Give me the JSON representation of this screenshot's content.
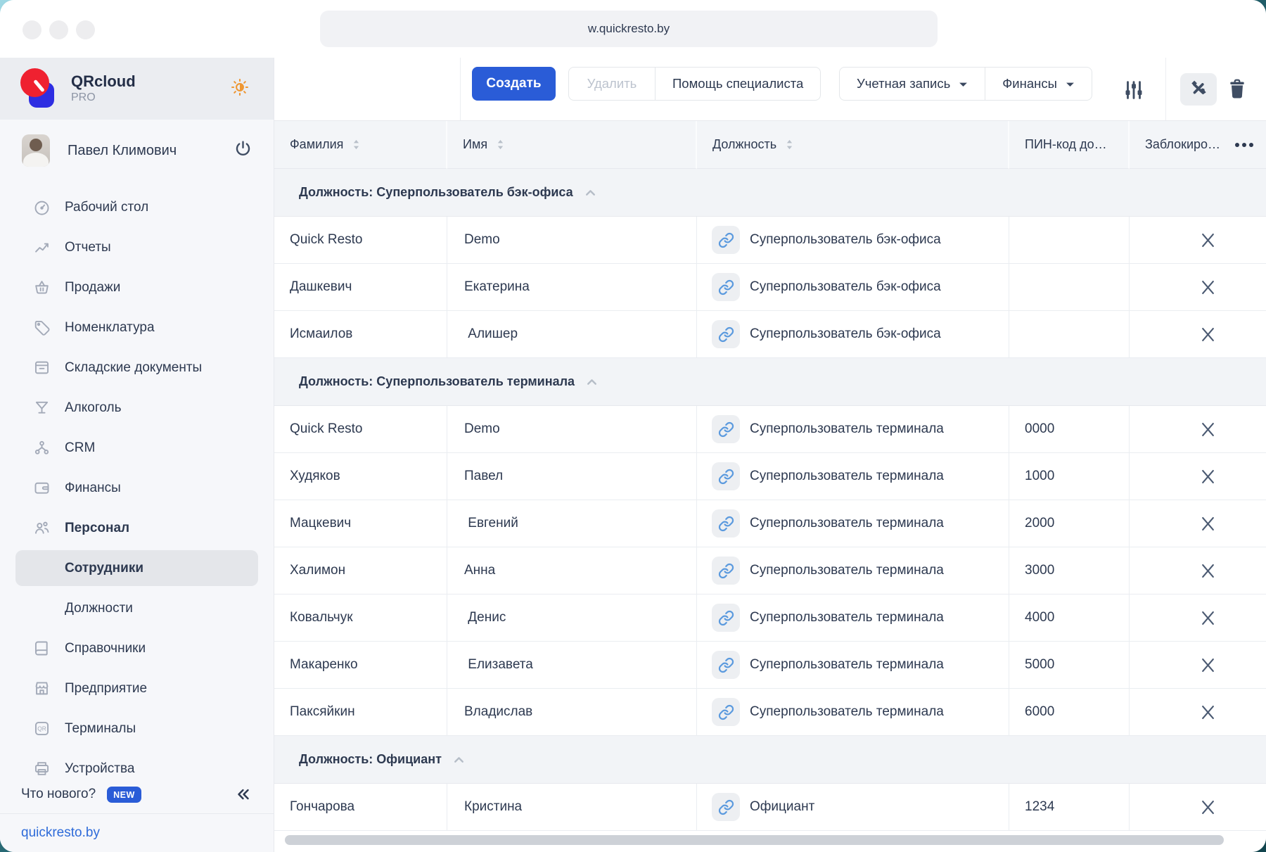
{
  "browser": {
    "url": "w.quickresto.by"
  },
  "colors": {
    "accent_blue": "#2a5cd7",
    "logo_red": "#ef2130",
    "logo_blue": "#2e2ee2",
    "link_icon_blue": "#5b9ade",
    "sun_orange": "#ee9733",
    "dark_icon": "#3f4d63",
    "disabled_text": "#bcc3ce"
  },
  "sidebar": {
    "logo": {
      "title": "QRcloud",
      "subtitle": "PRO"
    },
    "user": {
      "name": "Павел Климович"
    },
    "items": [
      {
        "key": "desktop",
        "label": "Рабочий стол",
        "icon": "dashboard-icon"
      },
      {
        "key": "reports",
        "label": "Отчеты",
        "icon": "reports-icon"
      },
      {
        "key": "sales",
        "label": "Продажи",
        "icon": "basket-icon"
      },
      {
        "key": "nomenclature",
        "label": "Номенклатура",
        "icon": "tag-icon"
      },
      {
        "key": "warehouse-docs",
        "label": "Складские документы",
        "icon": "warehouse-icon"
      },
      {
        "key": "alcohol",
        "label": "Алкоголь",
        "icon": "cocktail-icon"
      },
      {
        "key": "crm",
        "label": "CRM",
        "icon": "crm-icon"
      },
      {
        "key": "finance",
        "label": "Финансы",
        "icon": "wallet-icon"
      },
      {
        "key": "staff",
        "label": "Персонал",
        "icon": "people-icon",
        "bold": true
      },
      {
        "key": "employees",
        "label": "Сотрудники",
        "child": true,
        "selected": true
      },
      {
        "key": "positions",
        "label": "Должности",
        "child": true
      },
      {
        "key": "references",
        "label": "Справочники",
        "icon": "book-icon"
      },
      {
        "key": "enterprise",
        "label": "Предприятие",
        "icon": "storefront-icon"
      },
      {
        "key": "terminals",
        "label": "Терминалы",
        "icon": "qr-icon"
      },
      {
        "key": "devices",
        "label": "Устройства",
        "icon": "printer-icon"
      }
    ],
    "whats_new": {
      "label": "Что нового?",
      "badge": "NEW"
    },
    "site_link": "quickresto.by"
  },
  "toolbar": {
    "create_label": "Создать",
    "delete_label": "Удалить",
    "help_label": "Помощь специалиста",
    "account_label": "Учетная запись",
    "finance_label": "Финансы"
  },
  "table": {
    "columns": [
      {
        "key": "surname",
        "label": "Фамилия",
        "sortable": true
      },
      {
        "key": "name",
        "label": "Имя",
        "sortable": true
      },
      {
        "key": "role",
        "label": "Должность",
        "sortable": true
      },
      {
        "key": "pin",
        "label": "ПИН-код до…",
        "sortable": false
      },
      {
        "key": "blocked",
        "label": "Заблокиро…",
        "sortable": false
      }
    ],
    "groups": [
      {
        "title": "Должность: Суперпользователь бэк-офиса",
        "rows": [
          {
            "surname": "Quick Resto",
            "name": "Demo",
            "role": "Суперпользователь бэк-офиса",
            "pin": ""
          },
          {
            "surname": "Дашкевич",
            "name": "Екатерина",
            "role": "Суперпользователь бэк-офиса",
            "pin": ""
          },
          {
            "surname": "Исмаилов",
            "name": " Алишер",
            "role": "Суперпользователь бэк-офиса",
            "pin": ""
          }
        ]
      },
      {
        "title": "Должность: Суперпользователь терминала",
        "rows": [
          {
            "surname": "Quick Resto",
            "name": "Demo",
            "role": "Суперпользователь терминала",
            "pin": "0000"
          },
          {
            "surname": "Худяков",
            "name": "Павел",
            "role": "Суперпользователь терминала",
            "pin": "1000"
          },
          {
            "surname": "Мацкевич",
            "name": " Евгений",
            "role": "Суперпользователь терминала",
            "pin": "2000"
          },
          {
            "surname": "Халимон",
            "name": "Анна",
            "role": "Суперпользователь терминала",
            "pin": "3000"
          },
          {
            "surname": "Ковальчук",
            "name": " Денис",
            "role": "Суперпользователь терминала",
            "pin": "4000"
          },
          {
            "surname": "Макаренко",
            "name": " Елизавета",
            "role": "Суперпользователь терминала",
            "pin": "5000"
          },
          {
            "surname": "Паксяйкин",
            "name": "Владислав",
            "role": "Суперпользователь терминала",
            "pin": "6000"
          }
        ]
      },
      {
        "title": "Должность: Официант",
        "rows": [
          {
            "surname": "Гончарова",
            "name": "Кристина",
            "role": "Официант",
            "pin": "1234"
          }
        ]
      }
    ]
  }
}
